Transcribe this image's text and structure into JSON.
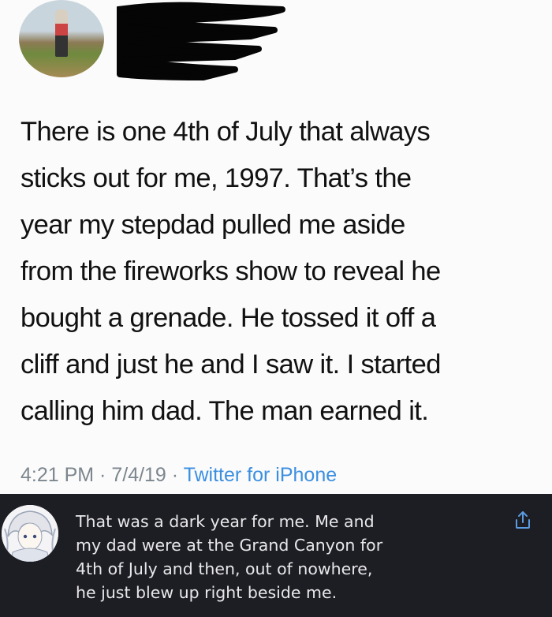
{
  "tweet": {
    "text": "There is one 4th of July that always\nsticks out for me, 1997. That’s the\nyear my stepdad pulled me aside\nfrom the fireworks show to reveal he\nbought a grenade. He tossed it off a\ncliff and just he and I saw it. I started\ncalling him dad. The man earned it.",
    "time": "4:21 PM",
    "date": "7/4/19",
    "separator": " · ",
    "source": "Twitter for iPhone"
  },
  "reply": {
    "text": "That was a dark year for me. Me and\nmy dad were at the Grand Canyon for\n4th of July and then, out of nowhere,\nhe just blew up right beside me.",
    "icon": "share-icon"
  },
  "colors": {
    "meta_gray": "#7d868e",
    "link_blue": "#3b8fe0",
    "reply_background": "#1d1e24"
  }
}
